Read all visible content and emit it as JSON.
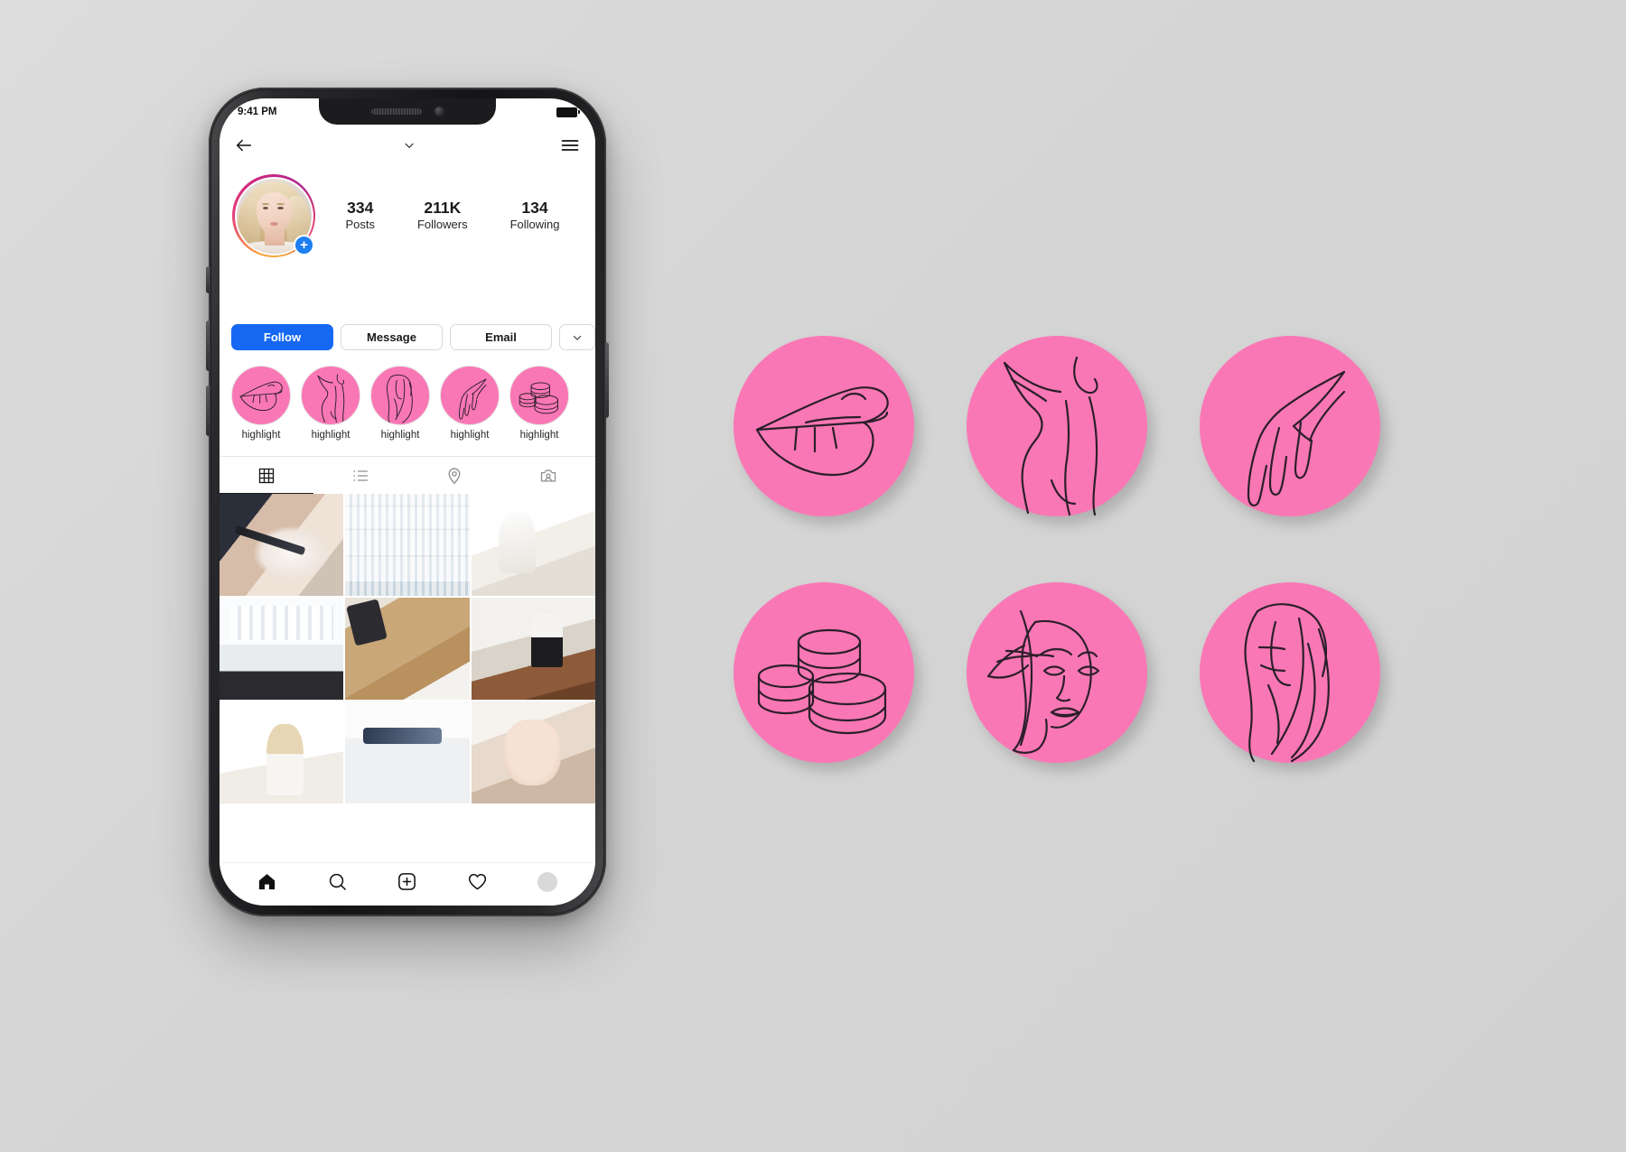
{
  "status_bar": {
    "time": "9:41 PM",
    "battery_icon": "battery-icon"
  },
  "header": {
    "back_icon": "back-arrow-icon",
    "title": "",
    "chevron_icon": "chevron-down-icon",
    "menu_icon": "hamburger-menu-icon"
  },
  "profile": {
    "avatar_name": "profile-avatar",
    "add_story_label": "+",
    "stats": [
      {
        "value": "334",
        "label": "Posts"
      },
      {
        "value": "211K",
        "label": "Followers"
      },
      {
        "value": "134",
        "label": "Following"
      }
    ]
  },
  "actions": {
    "follow_label": "Follow",
    "message_label": "Message",
    "email_label": "Email",
    "more_icon": "chevron-down-icon"
  },
  "highlights": [
    {
      "label": "highlight",
      "icon": "lips-icon"
    },
    {
      "label": "highlight",
      "icon": "body-back-icon"
    },
    {
      "label": "highlight",
      "icon": "long-hair-icon"
    },
    {
      "label": "highlight",
      "icon": "hand-icon"
    },
    {
      "label": "highlight",
      "icon": "cosmetic-jars-icon"
    }
  ],
  "tabs": [
    {
      "name": "grid-tab",
      "icon": "grid-icon",
      "active": true
    },
    {
      "name": "list-tab",
      "icon": "list-icon",
      "active": false
    },
    {
      "name": "location-tab",
      "icon": "location-icon",
      "active": false
    },
    {
      "name": "tagged-tab",
      "icon": "tagged-icon",
      "active": false
    }
  ],
  "grid_posts": [
    {
      "alt": "microblading-treatment-closeup"
    },
    {
      "alt": "skincare-product-shelves"
    },
    {
      "alt": "beautician-treating-client"
    },
    {
      "alt": "salon-interior-mirrors"
    },
    {
      "alt": "hair-styling-curling-iron"
    },
    {
      "alt": "woman-seated-on-sofa"
    },
    {
      "alt": "blonde-woman-portrait"
    },
    {
      "alt": "beauty-device-closeup"
    },
    {
      "alt": "facial-treatment-closeup"
    }
  ],
  "bottom_nav": [
    {
      "name": "home",
      "icon": "home-icon",
      "active": true
    },
    {
      "name": "search",
      "icon": "search-icon",
      "active": false
    },
    {
      "name": "create",
      "icon": "plus-square-icon",
      "active": false
    },
    {
      "name": "activity",
      "icon": "heart-icon",
      "active": false
    },
    {
      "name": "profile",
      "icon": "avatar-icon",
      "active": false
    }
  ],
  "cover_set": [
    {
      "name": "lips-cover",
      "icon": "lips-icon"
    },
    {
      "name": "body-back-cover",
      "icon": "body-back-icon"
    },
    {
      "name": "hand-cover",
      "icon": "hand-icon"
    },
    {
      "name": "cosmetic-jars-cover",
      "icon": "cosmetic-jars-icon"
    },
    {
      "name": "brow-makeup-cover",
      "icon": "brow-makeup-face-icon"
    },
    {
      "name": "long-hair-cover",
      "icon": "long-hair-icon"
    }
  ],
  "colors": {
    "background": "#d6d6d6",
    "cover_pink": "#fa77b5",
    "line_art": "#2b1f2a",
    "follow_blue": "#1668f2",
    "story_blue": "#1d7ff2",
    "text_dark": "#262626"
  }
}
